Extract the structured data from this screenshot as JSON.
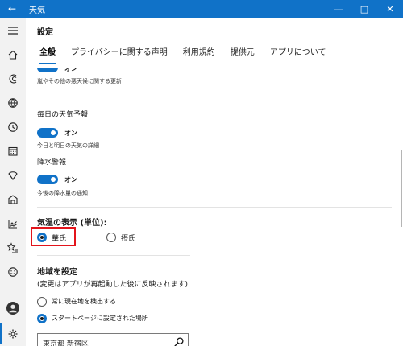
{
  "window": {
    "title": "天気",
    "back_glyph": "←",
    "minimize_glyph": "—",
    "maximize_glyph": "□",
    "close_glyph": "✕",
    "accent": "#1072c8"
  },
  "rail": {
    "items": [
      "menu-icon",
      "home-icon",
      "forecast-icon",
      "globe-icon",
      "clock-icon",
      "calendar-icon",
      "shield-icon",
      "building-icon",
      "chart-icon",
      "star-list-icon",
      "smile-icon",
      "avatar",
      "gear-icon"
    ]
  },
  "page": {
    "title": "設定"
  },
  "tabs": [
    {
      "label": "全般",
      "active": true
    },
    {
      "label": "プライバシーに関する声明",
      "active": false
    },
    {
      "label": "利用規約",
      "active": false
    },
    {
      "label": "提供元",
      "active": false
    },
    {
      "label": "アプリについて",
      "active": false
    }
  ],
  "settings": {
    "toggle_on_label": "オン",
    "severe_weather": {
      "label": "オン",
      "description": "嵐やその他の悪天候に関する更新"
    },
    "daily_forecast": {
      "label": "毎日の天気予報",
      "state": "オン",
      "description": "今日と明日の天気の詳細"
    },
    "precipitation": {
      "label": "降水警報",
      "state": "オン",
      "description": "今後の降水量の通知"
    }
  },
  "temperature": {
    "heading": "気温の表示 (単位):",
    "options": [
      {
        "label": "華氏",
        "selected": true
      },
      {
        "label": "摂氏",
        "selected": false
      }
    ],
    "highlight_color": "#e3141b"
  },
  "location": {
    "heading": "地域を設定",
    "note": "(変更はアプリが再起動した後に反映されます)",
    "options": [
      {
        "label": "常に現在地を検出する",
        "selected": false
      },
      {
        "label": "スタートページに設定された場所",
        "selected": true
      }
    ],
    "search_value": "東京都 新宿区"
  }
}
